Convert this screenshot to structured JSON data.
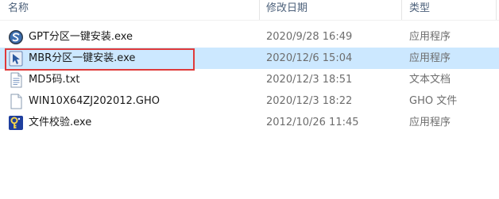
{
  "columns": {
    "name": "名称",
    "date": "修改日期",
    "type": "类型"
  },
  "files": [
    {
      "name": "GPT分区一键安装.exe",
      "date": "2020/9/28 16:49",
      "type": "应用程序",
      "icon": "gpt-app-icon",
      "selected": false
    },
    {
      "name": "MBR分区一键安装.exe",
      "date": "2020/12/6 15:04",
      "type": "应用程序",
      "icon": "mbr-app-icon",
      "selected": true
    },
    {
      "name": "MD5码.txt",
      "date": "2020/12/3 18:51",
      "type": "文本文档",
      "icon": "text-file-icon",
      "selected": false
    },
    {
      "name": "WIN10X64ZJ202012.GHO",
      "date": "2020/12/3 18:22",
      "type": "GHO 文件",
      "icon": "blank-file-icon",
      "selected": false
    },
    {
      "name": "文件校验.exe",
      "date": "2012/10/26 11:45",
      "type": "应用程序",
      "icon": "key-app-icon",
      "selected": false
    }
  ],
  "colors": {
    "selection_bg": "#cce8ff",
    "highlight_border": "#e03a3a",
    "header_text": "#4c607a"
  }
}
